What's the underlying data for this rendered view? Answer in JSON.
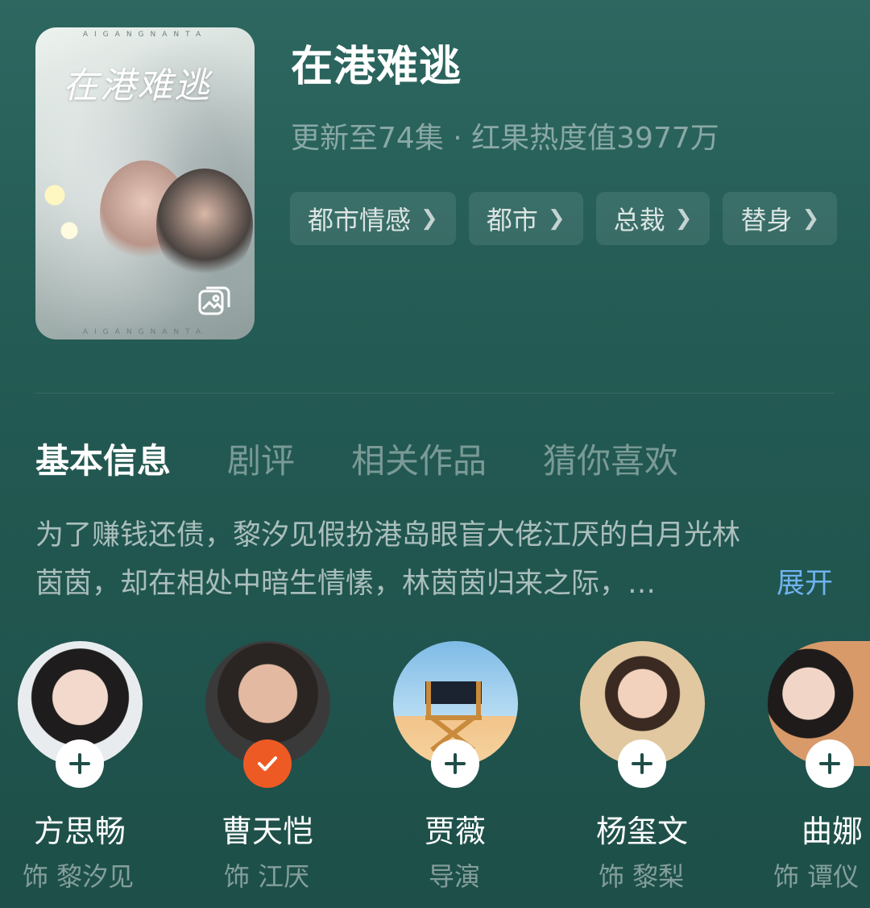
{
  "poster": {
    "title_art": "在港难逃",
    "top_caption": "AIGANGNANTA",
    "bottom_caption": "AIGANGNANTA",
    "gallery_icon": "gallery-icon"
  },
  "drama": {
    "title": "在港难逃",
    "meta": "更新至74集 · 红果热度值3977万"
  },
  "tags": [
    {
      "label": "都市情感"
    },
    {
      "label": "都市"
    },
    {
      "label": "总裁"
    },
    {
      "label": "替身"
    }
  ],
  "tabs": [
    {
      "label": "基本信息",
      "active": true
    },
    {
      "label": "剧评",
      "active": false
    },
    {
      "label": "相关作品",
      "active": false
    },
    {
      "label": "猜你喜欢",
      "active": false
    }
  ],
  "description": {
    "line1": "为了赚钱还债，黎汐见假扮港岛眼盲大佬江厌的白月光林",
    "line2": "茵茵，却在相处中暗生情愫，林茵茵归来之际，…",
    "expand_label": "展开"
  },
  "cast": [
    {
      "name": "方思畅",
      "role": "饰 黎汐见",
      "followed": false
    },
    {
      "name": "曹天恺",
      "role": "饰 江厌",
      "followed": true
    },
    {
      "name": "贾薇",
      "role": "导演",
      "followed": false
    },
    {
      "name": "杨玺文",
      "role": "饰 黎梨",
      "followed": false
    },
    {
      "name": "曲娜",
      "role": "饰 谭仪",
      "followed": false
    }
  ],
  "colors": {
    "background": "#235a53",
    "follow_accent": "#ee5a24",
    "link": "#6fb3f0"
  }
}
